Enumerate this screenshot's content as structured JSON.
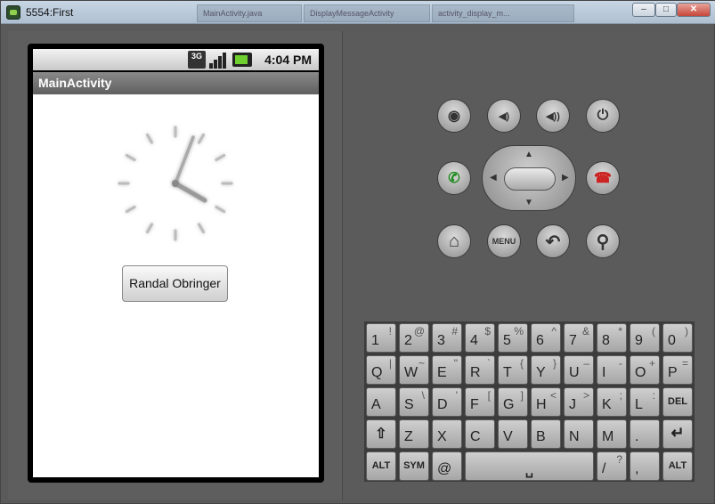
{
  "window": {
    "title": "5554:First",
    "background_tabs": [
      "MainActivity.java",
      "DisplayMessageActivity",
      "activity_display_m..."
    ],
    "controls": [
      "–",
      "□",
      "✕"
    ]
  },
  "statusbar": {
    "network": "3G",
    "time": "4:04 PM"
  },
  "app": {
    "title": "MainActivity",
    "button_label": "Randal Obringer"
  },
  "hardware": {
    "buttons": [
      {
        "name": "camera-button",
        "glyph": "◉"
      },
      {
        "name": "volume-down-button",
        "glyph": "◀)"
      },
      {
        "name": "volume-up-button",
        "glyph": "◀))"
      },
      {
        "name": "power-button",
        "glyph": "⏻"
      },
      {
        "name": "call-button",
        "glyph": "✆"
      },
      {
        "name": "end-call-button",
        "glyph": "☎"
      },
      {
        "name": "home-button",
        "glyph": "⌂"
      },
      {
        "name": "menu-button",
        "glyph": "MENU"
      },
      {
        "name": "back-button",
        "glyph": "↶"
      },
      {
        "name": "search-button",
        "glyph": "⚲"
      }
    ]
  },
  "keyboard": {
    "row1": [
      [
        "1",
        "!"
      ],
      [
        "2",
        "@"
      ],
      [
        "3",
        "#"
      ],
      [
        "4",
        "$"
      ],
      [
        "5",
        "%"
      ],
      [
        "6",
        "^"
      ],
      [
        "7",
        "&"
      ],
      [
        "8",
        "*"
      ],
      [
        "9",
        "("
      ],
      [
        "0",
        ")"
      ]
    ],
    "row2": [
      [
        "Q",
        "|"
      ],
      [
        "W",
        "~"
      ],
      [
        "E",
        "\""
      ],
      [
        "R",
        "`"
      ],
      [
        "T",
        "{"
      ],
      [
        "Y",
        "}"
      ],
      [
        "U",
        "–"
      ],
      [
        "I",
        "-"
      ],
      [
        "O",
        "+"
      ],
      [
        "P",
        "="
      ]
    ],
    "row3": [
      [
        "A",
        ""
      ],
      [
        "S",
        "\\"
      ],
      [
        "D",
        "'"
      ],
      [
        "F",
        "["
      ],
      [
        "G",
        "]"
      ],
      [
        "H",
        "<"
      ],
      [
        "J",
        ">"
      ],
      [
        "K",
        ";"
      ],
      [
        "L",
        ":"
      ],
      [
        "DEL",
        ""
      ]
    ],
    "row4": [
      [
        "⇧",
        ""
      ],
      [
        "Z",
        ""
      ],
      [
        "X",
        ""
      ],
      [
        "C",
        ""
      ],
      [
        "V",
        ""
      ],
      [
        "B",
        ""
      ],
      [
        "N",
        ""
      ],
      [
        "M",
        ""
      ],
      [
        ".",
        ""
      ],
      [
        "↵",
        ""
      ]
    ],
    "row5": [
      [
        "ALT",
        ""
      ],
      [
        "SYM",
        ""
      ],
      [
        "@",
        ""
      ],
      [
        "␣",
        ""
      ],
      [
        "/",
        "?"
      ],
      [
        ",",
        ""
      ],
      [
        "ALT",
        ""
      ]
    ]
  }
}
